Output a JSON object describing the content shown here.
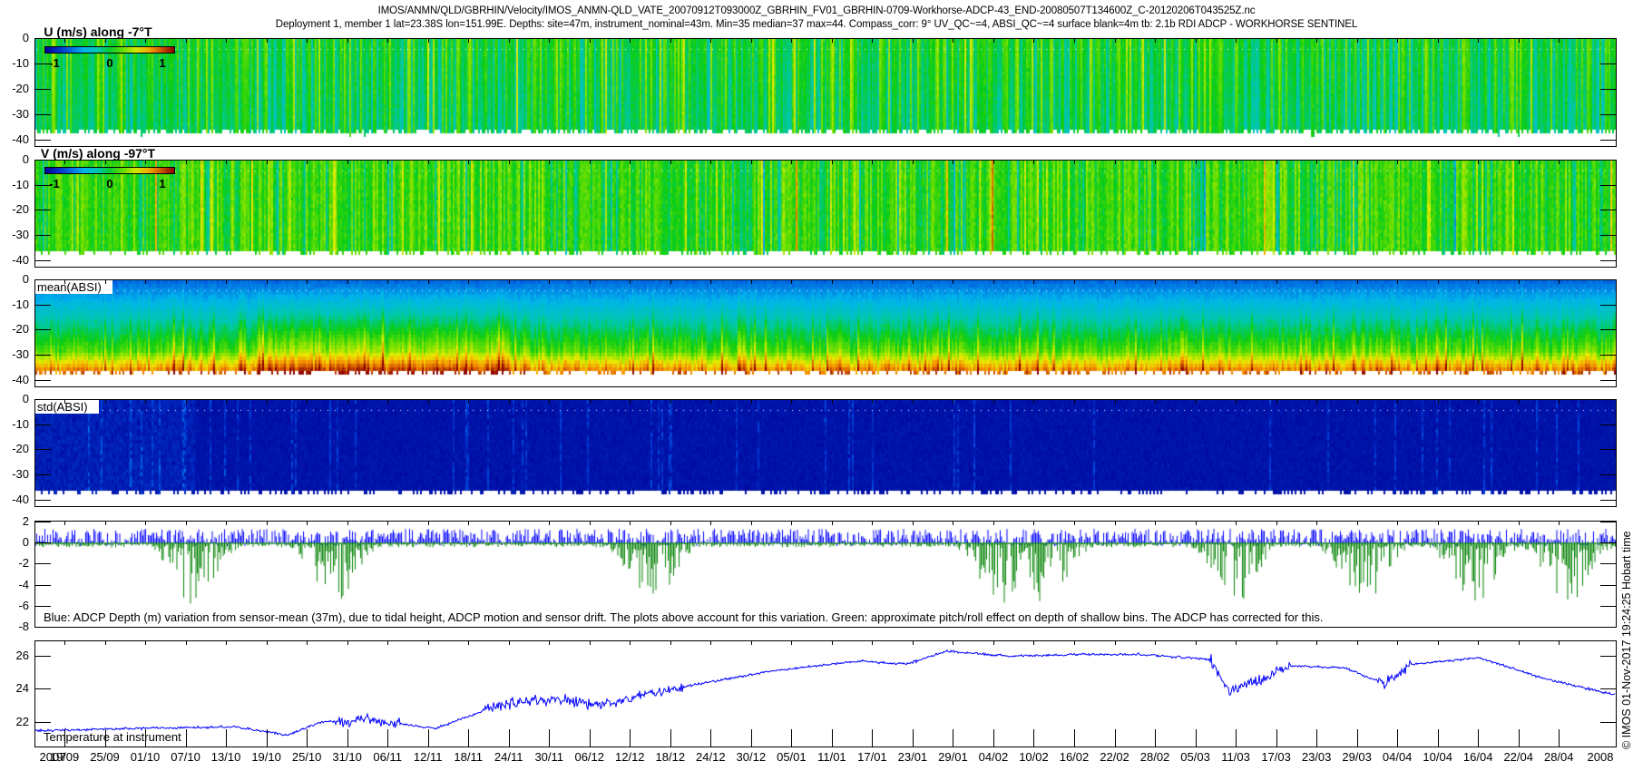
{
  "header": {
    "line1": "IMOS/ANMN/QLD/GBRHIN/Velocity/IMOS_ANMN-QLD_VATE_20070912T093000Z_GBRHIN_FV01_GBRHIN-0709-Workhorse-ADCP-43_END-20080507T134600Z_C-20120206T043525Z.nc",
    "line2": "Deployment 1, member 1 lat=23.38S lon=151.99E. Depths: site=47m, instrument_nominal=43m. Min=35 median=37 max=44. Compass_corr: 9° UV_QC~=4, ABSI_QC~=4 surface blank=4m tb: 2.1b RDI ADCP - WORKHORSE SENTINEL"
  },
  "credit": "© IMOS 01-Nov-2017 19:24:25 Hobart time",
  "colors": {
    "blue_line": "#0000ff",
    "green_line": "#008000",
    "axis": "#000000"
  },
  "chart_data": {
    "type": "multi-panel",
    "x_axis": {
      "tick_labels": [
        "19/09",
        "25/09",
        "01/10",
        "07/10",
        "13/10",
        "19/10",
        "25/10",
        "31/10",
        "06/11",
        "12/11",
        "18/11",
        "24/11",
        "30/11",
        "06/12",
        "12/12",
        "18/12",
        "24/12",
        "30/12",
        "05/01",
        "11/01",
        "17/01",
        "23/01",
        "29/01",
        "04/02",
        "10/02",
        "16/02",
        "22/02",
        "28/02",
        "05/03",
        "11/03",
        "17/03",
        "23/03",
        "29/03",
        "04/04",
        "10/04",
        "16/04",
        "22/04",
        "28/04"
      ],
      "tick_spacing_days": 6,
      "year_start": "2007",
      "year_end": "2008",
      "xlim_days_from_first_tick": [
        -4.5,
        230.6
      ]
    },
    "panels": [
      {
        "type": "heatmap",
        "title": "U (m/s) along -7°T",
        "ylim": [
          -43,
          0
        ],
        "yticks": [
          "0",
          "-10",
          "-20",
          "-30",
          "-40"
        ],
        "colorbar": {
          "ticks": [
            "-1",
            "0",
            "1"
          ],
          "range": [
            -1.2,
            1.2
          ]
        },
        "surface_blank_m": 4
      },
      {
        "type": "heatmap",
        "title": "V (m/s) along -97°T",
        "ylim": [
          -43,
          0
        ],
        "yticks": [
          "0",
          "-10",
          "-20",
          "-30",
          "-40"
        ],
        "colorbar": {
          "ticks": [
            "-1",
            "0",
            "1"
          ],
          "range": [
            -1.2,
            1.2
          ]
        },
        "surface_blank_m": 4
      },
      {
        "type": "heatmap",
        "label": "mean(ABSI)",
        "ylim": [
          -43,
          0
        ],
        "yticks": [
          "0",
          "-10",
          "-20",
          "-30",
          "-40"
        ]
      },
      {
        "type": "heatmap",
        "label": "std(ABSI)",
        "ylim": [
          -43,
          0
        ],
        "yticks": [
          "0",
          "-10",
          "-20",
          "-30",
          "-40"
        ]
      },
      {
        "type": "bar",
        "caption": "Blue: ADCP Depth (m) variation from sensor-mean (37m), due to tidal height, ADCP motion and sensor drift. The plots above account for this variation. Green: approximate pitch/roll effect on depth of shallow bins. The ADCP has corrected for this.",
        "ylim": [
          -8.1,
          2.1
        ],
        "yticks": [
          "2",
          "0",
          "-2",
          "-4",
          "-6",
          "-8"
        ],
        "series": [
          {
            "name": "ADCP depth variation",
            "color": "blue",
            "range": [
              -0.5,
              1.9
            ]
          },
          {
            "name": "pitch/roll effect",
            "color": "green",
            "range": [
              -8,
              0
            ]
          }
        ]
      },
      {
        "type": "line",
        "label": "Temperature at instrument",
        "ylim": [
          20.5,
          26.9
        ],
        "yticks": [
          "26",
          "24",
          "22"
        ],
        "series": {
          "name": "Temperature",
          "days": [
            -4.5,
            10,
            25,
            33,
            38,
            45,
            55,
            65,
            72,
            80,
            90,
            105,
            118,
            125,
            131,
            140,
            150,
            160,
            170,
            173,
            178,
            182,
            190,
            196,
            200,
            210,
            220,
            230.6
          ],
          "values": [
            21.45,
            21.6,
            21.7,
            21.2,
            22.0,
            22.1,
            21.6,
            23.1,
            23.4,
            23.0,
            24.0,
            25.1,
            25.7,
            25.5,
            26.3,
            26.0,
            26.1,
            26.1,
            25.8,
            23.8,
            24.6,
            25.4,
            25.3,
            24.3,
            25.5,
            25.9,
            24.6,
            23.6
          ]
        }
      }
    ]
  }
}
